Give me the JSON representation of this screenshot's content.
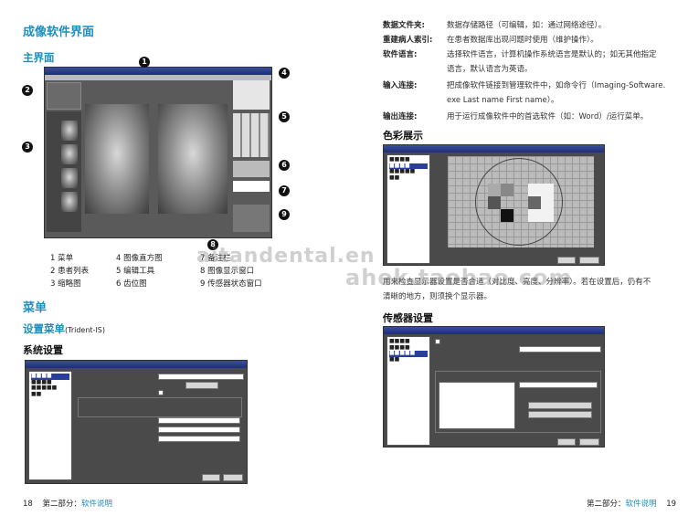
{
  "left": {
    "title": "成像软件界面",
    "main_ui": "主界面",
    "callouts": [
      "1",
      "2",
      "3",
      "4",
      "5",
      "6",
      "7",
      "8",
      "9"
    ],
    "legend": [
      [
        "1 菜单",
        "4 图像直方图",
        "7 备注栏"
      ],
      [
        "2 患者列表",
        "5 编辑工具",
        "8 图像显示窗口"
      ],
      [
        "3 缩略图",
        "6 齿位图",
        "9 传感器状态窗口"
      ]
    ],
    "menu_title": "菜单",
    "settings_menu": "设置菜单",
    "settings_menu_sub": "(Trident-IS)",
    "system_settings": "系统设置",
    "footer_page": "18",
    "footer_section": "第二部分：",
    "footer_section_name": "软件说明"
  },
  "right": {
    "rows": [
      {
        "label": "数据文件夹:",
        "text": [
          "数据存储路径（可编辑，如：通过网络途径）。"
        ]
      },
      {
        "label": "重建病人索引:",
        "text": [
          "在患者数据库出现问题时使用（维护操作）。"
        ]
      },
      {
        "label": "软件语言:",
        "text": [
          "选择软件语言，计算机操作系统语言是默认的；如无其他指定",
          "语言，默认语言为英语。"
        ]
      },
      {
        "label": "输入连接:",
        "text": [
          "把成像软件链接到管理软件中，如命令行（Imaging-Software.",
          "exe Last name First name）。"
        ]
      },
      {
        "label": "输出连接:",
        "text": [
          "用于运行成像软件中的首选软件（如：Word）/运行菜单。"
        ]
      }
    ],
    "color_title": "色彩展示",
    "color_desc": [
      "用来检查显示器设置是否合适（对比度、亮度、分辨率）。若在设置后，仍有不",
      "清晰的地方，则须换个显示器。"
    ],
    "sensor_title": "传感器设置",
    "footer_page": "19",
    "footer_section": "第二部分：",
    "footer_section_name": "软件说明"
  },
  "watermark": "aitandental.en",
  "watermark2": "ahek.taobao.com"
}
